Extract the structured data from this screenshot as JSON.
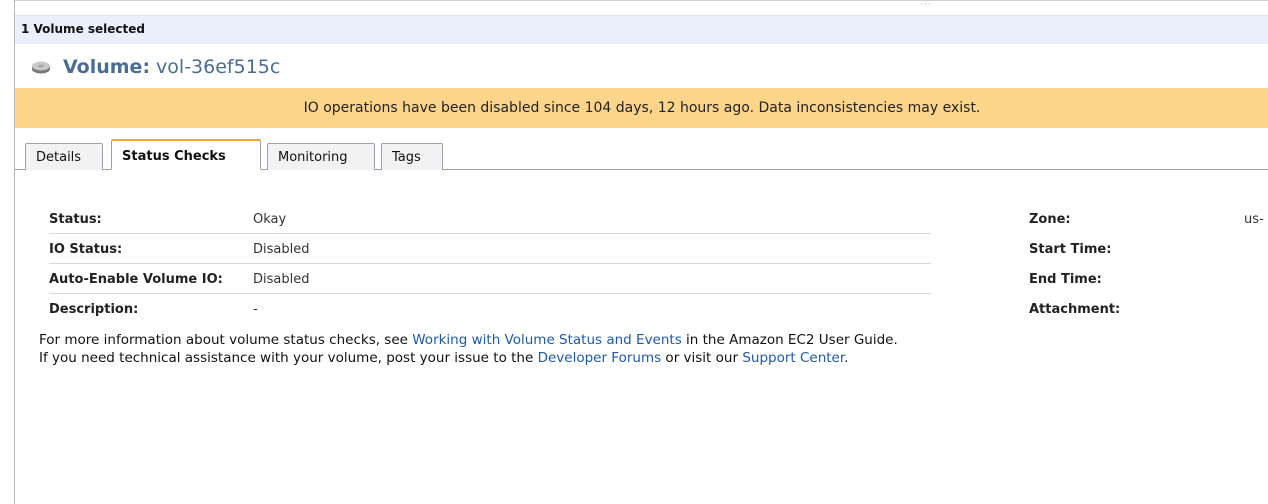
{
  "selection": {
    "label": "1 Volume selected"
  },
  "volume": {
    "label": "Volume:",
    "id": "vol-36ef515c",
    "icon": "disk-icon"
  },
  "warning": {
    "text": "IO operations have been disabled since 104 days, 12 hours ago. Data inconsistencies may exist.",
    "color": "#fcd58a"
  },
  "tabs": [
    {
      "label": "Details"
    },
    {
      "label": "Status Checks",
      "active": true
    },
    {
      "label": "Monitoring"
    },
    {
      "label": "Tags"
    }
  ],
  "left_fields": [
    {
      "key": "Status:",
      "value": "Okay"
    },
    {
      "key": "IO Status:",
      "value": "Disabled"
    },
    {
      "key": "Auto-Enable Volume IO:",
      "value": "Disabled"
    },
    {
      "key": "Description:",
      "value": "-"
    }
  ],
  "right_fields": [
    {
      "key": "Zone:",
      "value": "us-"
    },
    {
      "key": "Start Time:",
      "value": ""
    },
    {
      "key": "End Time:",
      "value": ""
    },
    {
      "key": "Attachment:",
      "value": ""
    }
  ],
  "info": {
    "line1_pre": "For more information about volume status checks, see ",
    "line1_link": "Working with Volume Status and Events",
    "line1_post": " in the Amazon EC2 User Guide.",
    "line2_pre": "If you need technical assistance with your volume, post your issue to the ",
    "line2_link1": "Developer Forums",
    "line2_mid": " or visit our ",
    "line2_link2": "Support Center",
    "line2_post": "."
  },
  "colors": {
    "accent_tab": "#f3a43a",
    "link": "#1f5aa6",
    "title": "#4a6d94",
    "selection_bg": "#e9f0fb"
  }
}
